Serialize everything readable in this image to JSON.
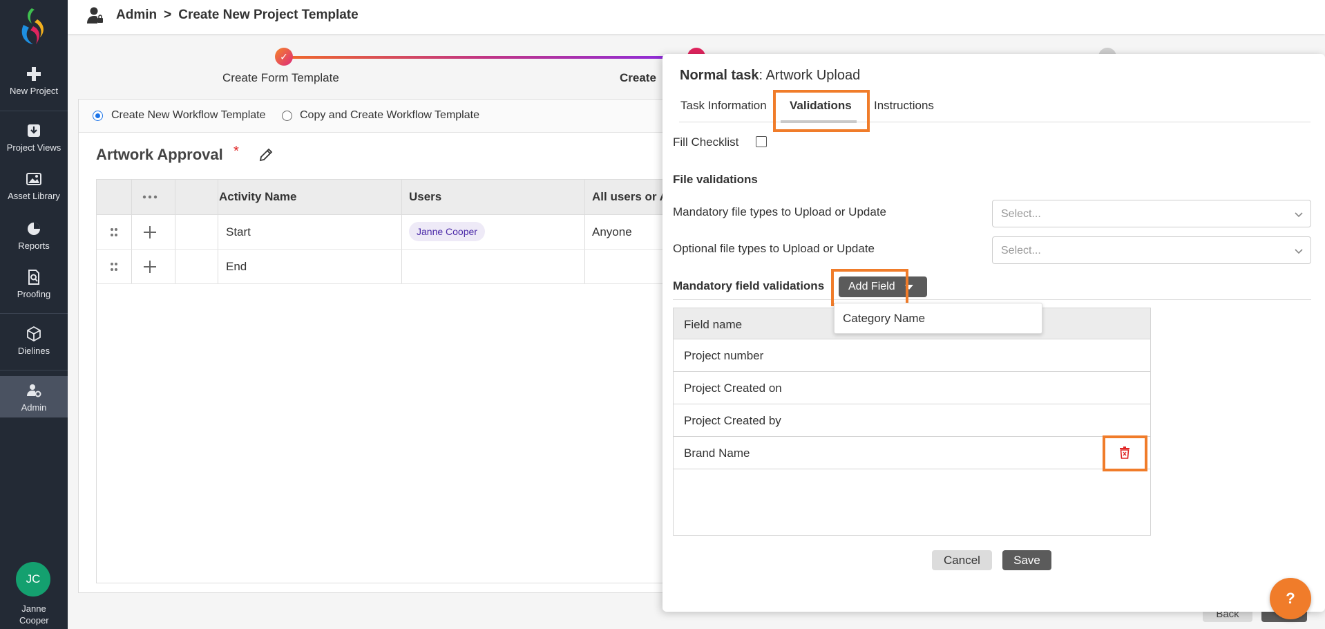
{
  "sidebar": {
    "items": [
      {
        "label": "New Project",
        "icon": "plus-icon"
      },
      {
        "label": "Project Views",
        "icon": "inbox-download-icon"
      },
      {
        "label": "Asset Library",
        "icon": "image-icon"
      },
      {
        "label": "Reports",
        "icon": "pie-chart-icon"
      },
      {
        "label": "Proofing",
        "icon": "document-search-icon"
      },
      {
        "label": "Dielines",
        "icon": "box-icon"
      },
      {
        "label": "Admin",
        "icon": "user-gear-icon",
        "active": true
      }
    ],
    "user": {
      "initials": "JC",
      "name": "Janne Cooper",
      "avatar_color": "#14a06f"
    }
  },
  "header": {
    "breadcrumb": [
      "Admin",
      "Create New Project Template"
    ],
    "separator": ">"
  },
  "stepper": {
    "steps": [
      {
        "label": "Create Form Template",
        "status": "done"
      },
      {
        "label": "Create",
        "status": "current"
      },
      {
        "label": "",
        "status": "upcoming"
      }
    ]
  },
  "workflow": {
    "mode_options": [
      {
        "label": "Create New Workflow Template",
        "selected": true
      },
      {
        "label": "Copy and Create Workflow Template",
        "selected": false
      }
    ],
    "title": "Artwork Approval",
    "required_mark": "*",
    "columns": [
      "Activity Name",
      "Users",
      "All users or A"
    ],
    "rows": [
      {
        "activity": "Start",
        "user": "Janne Cooper",
        "all_users": "Anyone"
      },
      {
        "activity": "End",
        "user": "",
        "all_users": ""
      }
    ]
  },
  "panel": {
    "task_type": "Normal task",
    "task_name": ": Artwork Upload",
    "tabs": [
      {
        "label": "Task Information",
        "active": false
      },
      {
        "label": "Validations",
        "active": true
      },
      {
        "label": "Instructions",
        "active": false
      }
    ],
    "fill_checklist_label": "Fill Checklist",
    "fill_checklist_checked": false,
    "file_validations_heading": "File validations",
    "mandatory_types_label": "Mandatory file types to Upload or Update",
    "optional_types_label": "Optional file types to Upload or Update",
    "select_placeholder": "Select...",
    "mandatory_field_heading": "Mandatory field validations",
    "add_field_label": "Add Field",
    "dropdown_options": [
      "Category Name"
    ],
    "field_table": {
      "header": "Field name",
      "rows": [
        "Project number",
        "Project Created on",
        "Project Created by",
        "Brand Name"
      ]
    },
    "cancel_label": "Cancel",
    "save_label": "Save"
  },
  "footer": {
    "back_label": "Back",
    "help_label": "?"
  },
  "colors": {
    "sidebar_bg": "#232a35",
    "highlight": "#f07c2a",
    "chip_text": "#4b2aa8",
    "delete_red": "#e02424"
  }
}
